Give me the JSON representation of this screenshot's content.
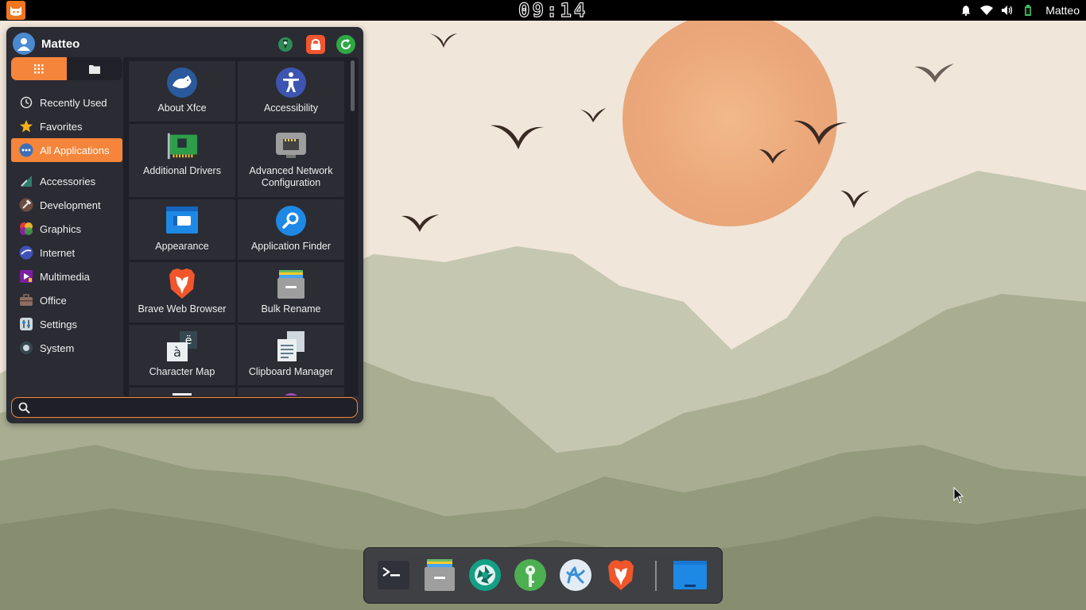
{
  "top_panel": {
    "clock": "09:14",
    "username": "Matteo"
  },
  "menu": {
    "user_name": "Matteo",
    "search": {
      "value": "",
      "placeholder": ""
    },
    "categories": [
      {
        "label": "Recently Used",
        "icon": "clock-icon"
      },
      {
        "label": "Favorites",
        "icon": "star-icon"
      },
      {
        "label": "All Applications",
        "icon": "all-apps-icon",
        "active": true
      },
      {
        "label": "Accessories",
        "icon": "accessories-icon"
      },
      {
        "label": "Development",
        "icon": "hammer-icon"
      },
      {
        "label": "Graphics",
        "icon": "graphics-icon"
      },
      {
        "label": "Internet",
        "icon": "globe-icon"
      },
      {
        "label": "Multimedia",
        "icon": "multimedia-icon"
      },
      {
        "label": "Office",
        "icon": "briefcase-icon"
      },
      {
        "label": "Settings",
        "icon": "settings-icon"
      },
      {
        "label": "System",
        "icon": "system-icon"
      }
    ],
    "apps": [
      {
        "label": "About Xfce",
        "icon": "xfce-mouse-icon"
      },
      {
        "label": "Accessibility",
        "icon": "accessibility-icon"
      },
      {
        "label": "Additional Drivers",
        "icon": "pci-card-icon"
      },
      {
        "label": "Advanced Network Configuration",
        "icon": "network-icon"
      },
      {
        "label": "Appearance",
        "icon": "appearance-icon"
      },
      {
        "label": "Application Finder",
        "icon": "app-finder-icon"
      },
      {
        "label": "Brave Web Browser",
        "icon": "brave-lion-icon"
      },
      {
        "label": "Bulk Rename",
        "icon": "bulk-rename-icon"
      },
      {
        "label": "Character Map",
        "icon": "charmap-icon"
      },
      {
        "label": "Clipboard Manager",
        "icon": "clipboard-icon"
      }
    ]
  },
  "dock": {
    "items": [
      {
        "name": "terminal",
        "icon": "terminal-icon"
      },
      {
        "name": "file-manager",
        "icon": "file-cabinet-icon"
      },
      {
        "name": "screenshot",
        "icon": "camera-shutter-icon"
      },
      {
        "name": "passwords",
        "icon": "key-icon"
      },
      {
        "name": "vscodium",
        "icon": "vscodium-icon"
      },
      {
        "name": "brave",
        "icon": "brave-lion-icon"
      },
      {
        "name": "show-desktop",
        "icon": "desktop-window-icon"
      }
    ]
  },
  "colors": {
    "accent": "#f5853a",
    "menu_bg": "#2a2b33",
    "panel_bg": "#000000"
  }
}
